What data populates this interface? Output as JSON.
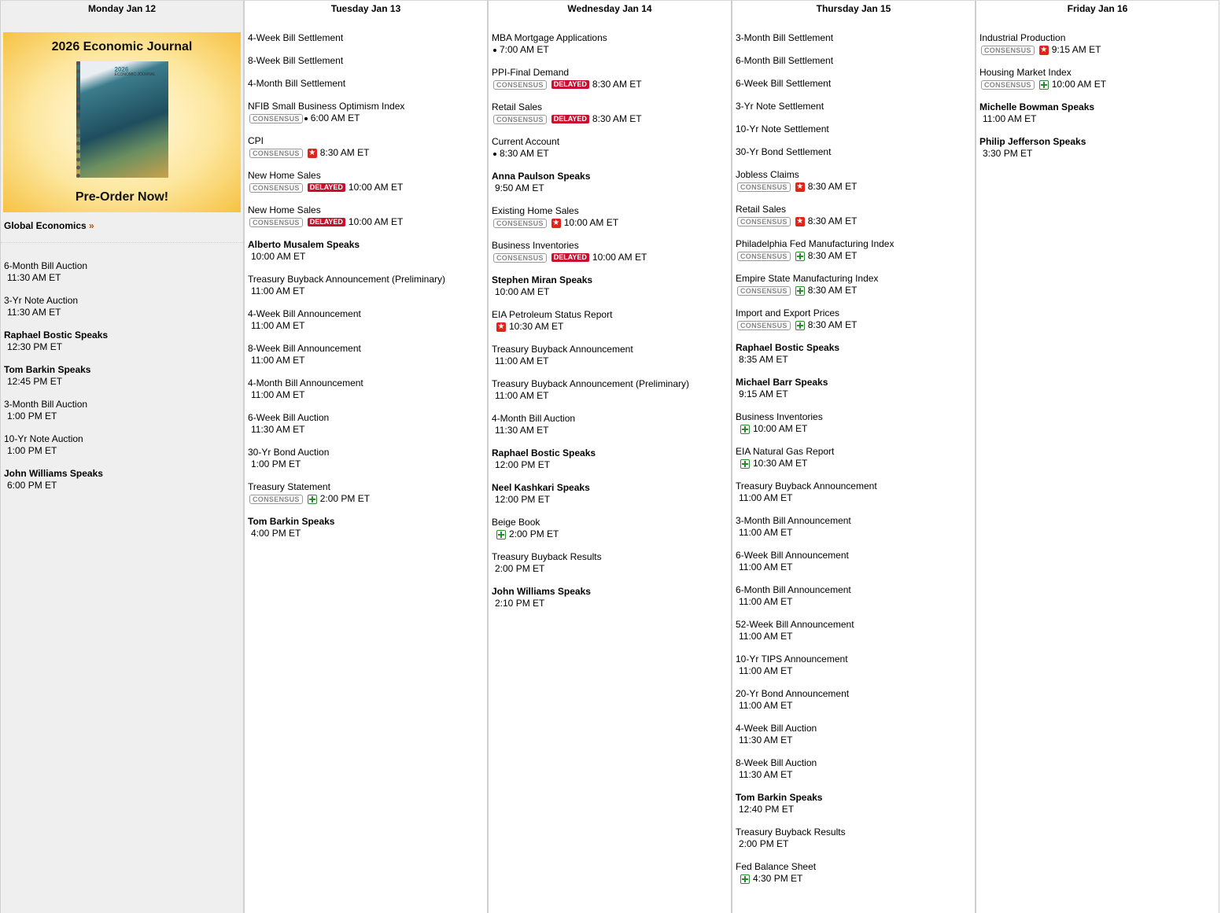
{
  "promo": {
    "title": "2026 Economic Journal",
    "cta": "Pre-Order Now!",
    "book_year": "2026",
    "book_subtitle": "ECONOMIC JOURNAL"
  },
  "global_link": {
    "label": "Global Economics",
    "arrow": "»"
  },
  "icon_glyphs": {
    "star": "★"
  },
  "badges": {
    "consensus": "CONSENSUS",
    "delayed": "DELAYED"
  },
  "days": [
    {
      "header": "Monday Jan 12",
      "events": [
        {
          "name": "6-Month Bill Auction",
          "time": "11:30 AM ET"
        },
        {
          "name": "3-Yr Note Auction",
          "time": "11:30 AM ET"
        },
        {
          "name": "Raphael Bostic Speaks",
          "time": "12:30 PM ET",
          "speaker": true
        },
        {
          "name": "Tom Barkin Speaks",
          "time": "12:45 PM ET",
          "speaker": true
        },
        {
          "name": "3-Month Bill Auction",
          "time": "1:00 PM ET"
        },
        {
          "name": "10-Yr Note Auction",
          "time": "1:00 PM ET"
        },
        {
          "name": "John Williams Speaks",
          "time": "6:00 PM ET",
          "speaker": true
        }
      ]
    },
    {
      "header": "Tuesday Jan 13",
      "events": [
        {
          "name": "4-Week Bill Settlement"
        },
        {
          "name": "8-Week Bill Settlement"
        },
        {
          "name": "4-Month Bill Settlement"
        },
        {
          "name": "NFIB Small Business Optimism Index",
          "time": "6:00 AM ET",
          "consensus": true,
          "icon": "dot"
        },
        {
          "name": "CPI",
          "time": "8:30 AM ET",
          "consensus": true,
          "icon": "star"
        },
        {
          "name": "New Home Sales",
          "time": "10:00 AM ET",
          "consensus": true,
          "delayed": true
        },
        {
          "name": "New Home Sales",
          "time": "10:00 AM ET",
          "consensus": true,
          "delayed": true
        },
        {
          "name": "Alberto Musalem Speaks",
          "time": "10:00 AM ET",
          "speaker": true
        },
        {
          "name": "Treasury Buyback Announcement (Preliminary)",
          "time": "11:00 AM ET"
        },
        {
          "name": "4-Week Bill Announcement",
          "time": "11:00 AM ET"
        },
        {
          "name": "8-Week Bill Announcement",
          "time": "11:00 AM ET"
        },
        {
          "name": "4-Month Bill Announcement",
          "time": "11:00 AM ET"
        },
        {
          "name": "6-Week Bill Auction",
          "time": "11:30 AM ET"
        },
        {
          "name": "30-Yr Bond Auction",
          "time": "1:00 PM ET"
        },
        {
          "name": "Treasury Statement",
          "time": "2:00 PM ET",
          "consensus": true,
          "icon": "plus"
        },
        {
          "name": "Tom Barkin Speaks",
          "time": "4:00 PM ET",
          "speaker": true
        }
      ]
    },
    {
      "header": "Wednesday Jan 14",
      "events": [
        {
          "name": "MBA Mortgage Applications",
          "time": "7:00 AM ET",
          "icon": "dot"
        },
        {
          "name": "PPI-Final Demand",
          "time": "8:30 AM ET",
          "consensus": true,
          "delayed": true
        },
        {
          "name": "Retail Sales",
          "time": "8:30 AM ET",
          "consensus": true,
          "delayed": true
        },
        {
          "name": "Current Account",
          "time": "8:30 AM ET",
          "icon": "dot"
        },
        {
          "name": "Anna Paulson Speaks",
          "time": "9:50 AM ET",
          "speaker": true
        },
        {
          "name": "Existing Home Sales",
          "time": "10:00 AM ET",
          "consensus": true,
          "icon": "star"
        },
        {
          "name": "Business Inventories",
          "time": "10:00 AM ET",
          "consensus": true,
          "delayed": true
        },
        {
          "name": "Stephen Miran Speaks",
          "time": "10:00 AM ET",
          "speaker": true
        },
        {
          "name": "EIA Petroleum Status Report",
          "time": "10:30 AM ET",
          "icon": "star"
        },
        {
          "name": "Treasury Buyback Announcement",
          "time": "11:00 AM ET"
        },
        {
          "name": "Treasury Buyback Announcement (Preliminary)",
          "time": "11:00 AM ET"
        },
        {
          "name": "4-Month Bill Auction",
          "time": "11:30 AM ET"
        },
        {
          "name": "Raphael Bostic Speaks",
          "time": "12:00 PM ET",
          "speaker": true
        },
        {
          "name": "Neel Kashkari Speaks",
          "time": "12:00 PM ET",
          "speaker": true
        },
        {
          "name": "Beige Book",
          "time": "2:00 PM ET",
          "icon": "plus"
        },
        {
          "name": "Treasury Buyback Results",
          "time": "2:00 PM ET"
        },
        {
          "name": "John Williams Speaks",
          "time": "2:10 PM ET",
          "speaker": true
        }
      ]
    },
    {
      "header": "Thursday Jan 15",
      "events": [
        {
          "name": "3-Month Bill Settlement"
        },
        {
          "name": "6-Month Bill Settlement"
        },
        {
          "name": "6-Week Bill Settlement"
        },
        {
          "name": "3-Yr Note Settlement"
        },
        {
          "name": "10-Yr Note Settlement"
        },
        {
          "name": "30-Yr Bond Settlement"
        },
        {
          "name": "Jobless Claims",
          "time": "8:30 AM ET",
          "consensus": true,
          "icon": "star"
        },
        {
          "name": "Retail Sales",
          "time": "8:30 AM ET",
          "consensus": true,
          "icon": "star"
        },
        {
          "name": "Philadelphia Fed Manufacturing Index",
          "time": "8:30 AM ET",
          "consensus": true,
          "icon": "plus"
        },
        {
          "name": "Empire State Manufacturing Index",
          "time": "8:30 AM ET",
          "consensus": true,
          "icon": "plus"
        },
        {
          "name": "Import and Export Prices",
          "time": "8:30 AM ET",
          "consensus": true,
          "icon": "plus"
        },
        {
          "name": "Raphael Bostic Speaks",
          "time": "8:35 AM ET",
          "speaker": true
        },
        {
          "name": "Michael Barr Speaks",
          "time": "9:15 AM ET",
          "speaker": true
        },
        {
          "name": "Business Inventories",
          "time": "10:00 AM ET",
          "icon": "plus"
        },
        {
          "name": "EIA Natural Gas Report",
          "time": "10:30 AM ET",
          "icon": "plus"
        },
        {
          "name": "Treasury Buyback Announcement",
          "time": "11:00 AM ET"
        },
        {
          "name": "3-Month Bill Announcement",
          "time": "11:00 AM ET"
        },
        {
          "name": "6-Week Bill Announcement",
          "time": "11:00 AM ET"
        },
        {
          "name": "6-Month Bill Announcement",
          "time": "11:00 AM ET"
        },
        {
          "name": "52-Week Bill Announcement",
          "time": "11:00 AM ET"
        },
        {
          "name": "10-Yr TIPS Announcement",
          "time": "11:00 AM ET"
        },
        {
          "name": "20-Yr Bond Announcement",
          "time": "11:00 AM ET"
        },
        {
          "name": "4-Week Bill Auction",
          "time": "11:30 AM ET"
        },
        {
          "name": "8-Week Bill Auction",
          "time": "11:30 AM ET"
        },
        {
          "name": "Tom Barkin Speaks",
          "time": "12:40 PM ET",
          "speaker": true
        },
        {
          "name": "Treasury Buyback Results",
          "time": "2:00 PM ET"
        },
        {
          "name": "Fed Balance Sheet",
          "time": "4:30 PM ET",
          "icon": "plus"
        }
      ]
    },
    {
      "header": "Friday Jan 16",
      "events": [
        {
          "name": "Industrial Production",
          "time": "9:15 AM ET",
          "consensus": true,
          "icon": "star"
        },
        {
          "name": "Housing Market Index",
          "time": "10:00 AM ET",
          "consensus": true,
          "icon": "plus"
        },
        {
          "name": "Michelle Bowman Speaks",
          "time": "11:00 AM ET",
          "speaker": true
        },
        {
          "name": "Philip Jefferson Speaks",
          "time": "3:30 PM ET",
          "speaker": true
        }
      ]
    }
  ]
}
